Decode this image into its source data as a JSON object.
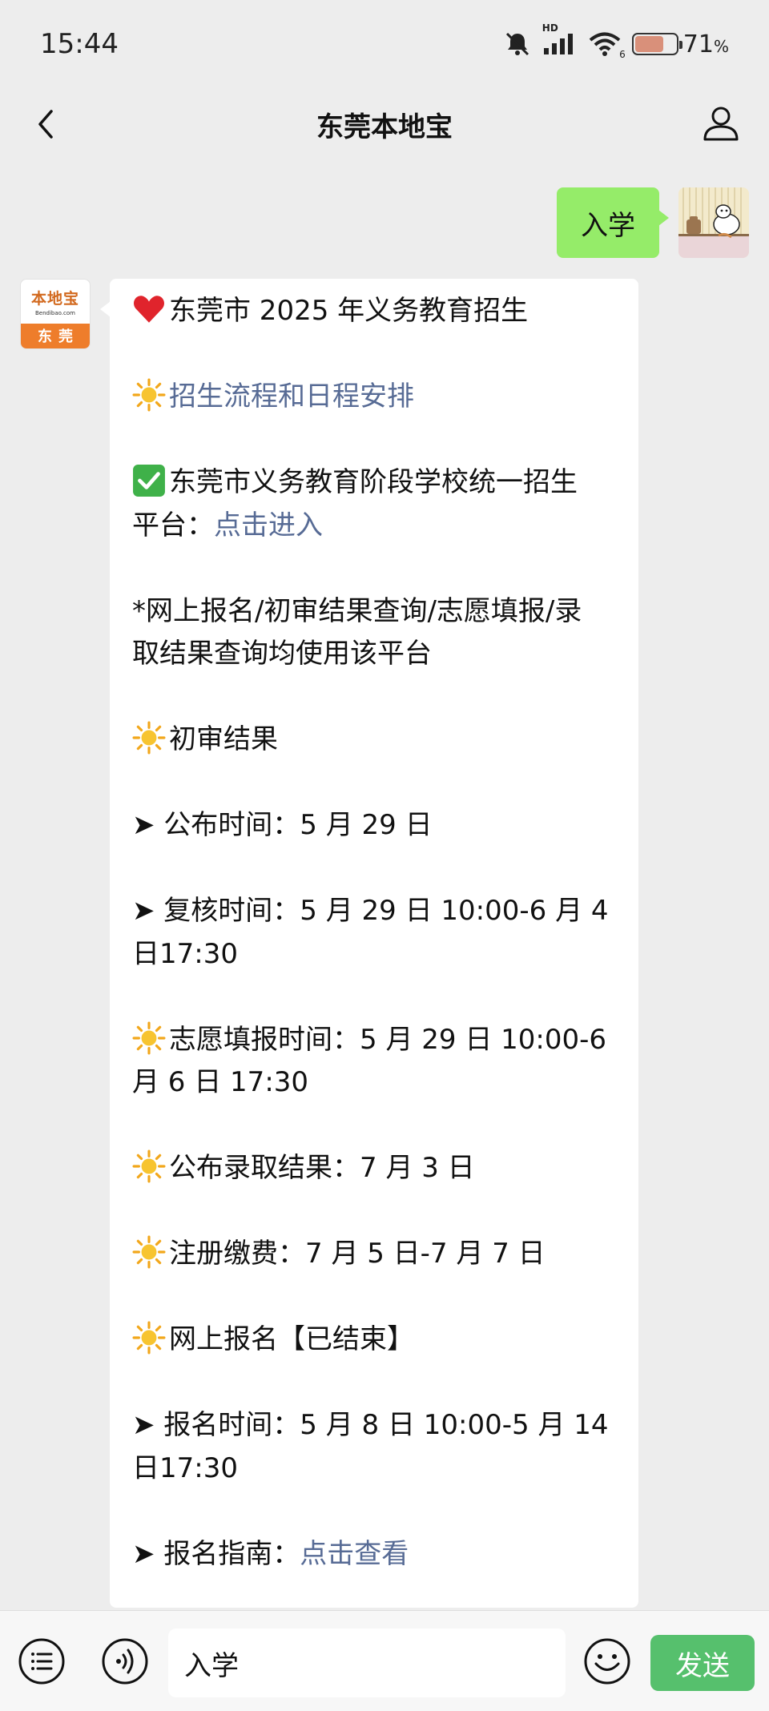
{
  "status": {
    "time": "15:44",
    "network_label": "HD",
    "signal_label": "6",
    "battery_percent": "71",
    "battery_unit": "%",
    "battery_level": 0.71
  },
  "header": {
    "title": "东莞本地宝"
  },
  "outgoing": {
    "text": "入学"
  },
  "bot_avatar": {
    "brand": "本地宝",
    "domain": "Bendibao.com",
    "city": "东莞"
  },
  "reply": {
    "title": "东莞市 2025 年义务教育招生",
    "process_link": "招生流程和日程安排",
    "platform_line1": "东莞市义务教育阶段学校统一招生",
    "platform_prefix": "平台：",
    "platform_link": "点击进入",
    "note_line1": "*网上报名/初审结果查询/志愿填报/录",
    "note_line2": "取结果查询均使用该平台",
    "initial_review": "初审结果",
    "publish_time": "➤ 公布时间：5 月 29 日",
    "recheck_line1": "➤ 复核时间：5 月 29 日 10:00-6 月 4",
    "recheck_line2": "日17:30",
    "wish_line1": "志愿填报时间：5 月 29 日 10:00-6",
    "wish_line2": "月 6 日 17:30",
    "result_publish": "公布录取结果：7 月 3 日",
    "registration_fee": "注册缴费：7 月 5 日-7 月 7 日",
    "online_signup": "网上报名【已结束】",
    "signup_time_line1": "➤ 报名时间：5 月 8 日 10:00-5 月 14",
    "signup_time_line2": "日17:30",
    "guide_prefix": "➤ 报名指南：",
    "guide_link": "点击查看"
  },
  "input_bar": {
    "value": "入学",
    "send_label": "发送"
  },
  "colors": {
    "background": "#ededed",
    "bubble_out": "#95ec69",
    "link": "#576b95",
    "send_button": "#56c06d",
    "brand_orange": "#ee7d2b"
  },
  "icons": [
    "bell-icon",
    "signal-icon",
    "wifi-icon",
    "battery-icon",
    "back-icon",
    "profile-icon",
    "heart-icon",
    "sun-icon",
    "check-icon",
    "menu-list-icon",
    "voice-icon",
    "emoji-icon"
  ]
}
